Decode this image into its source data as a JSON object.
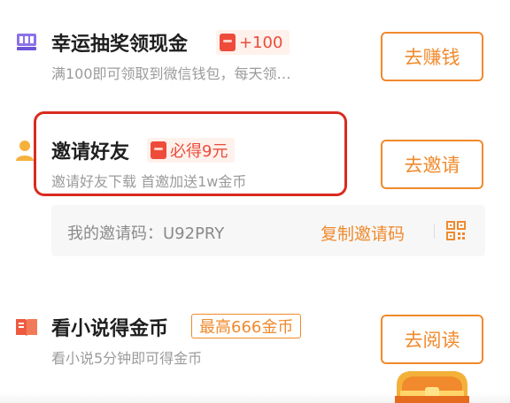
{
  "tasks": [
    {
      "icon": "prize-machine-icon",
      "title": "幸运抽奖领现金",
      "badge": "+100",
      "desc": "满100即可领取到微信钱包，每天领…",
      "button": "去赚钱"
    },
    {
      "icon": "person-icon",
      "title": "邀请好友",
      "badge": "必得9元",
      "desc": "邀请好友下载 首邀加送1w金币",
      "button": "去邀请"
    },
    {
      "icon": "book-icon",
      "title": "看小说得金币",
      "badge": "最高666金币",
      "desc": "看小说5分钟即可得金币",
      "button": "去阅读"
    }
  ],
  "invite": {
    "label": "我的邀请码：U92PRY",
    "copy_label": "复制邀请码",
    "qr_icon": "qr-code-icon"
  },
  "colors": {
    "accent": "#f08a2c",
    "badge_red": "#e94d3b",
    "highlight": "#d92b1f"
  }
}
